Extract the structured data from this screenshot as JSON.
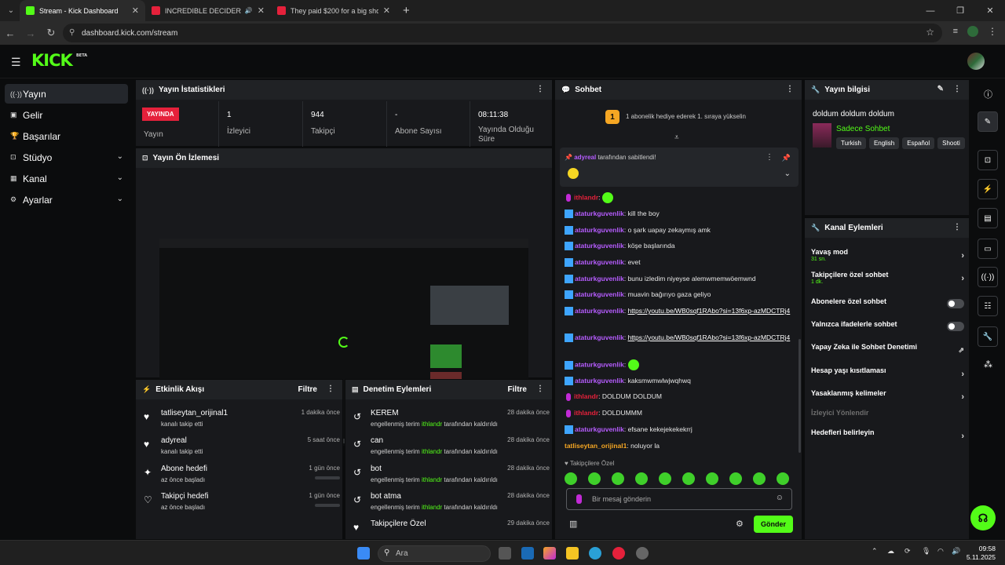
{
  "browser": {
    "tabs": [
      {
        "title": "Stream - Kick Dashboard",
        "active": true
      },
      {
        "title": "INCREDIBLE DECIDER | Roni",
        "active": false
      },
      {
        "title": "They paid $200 for a big shock",
        "active": false
      }
    ],
    "url": "dashboard.kick.com/stream"
  },
  "logo": {
    "text": "KICK",
    "beta": "BETA"
  },
  "sidebar": {
    "items": [
      {
        "label": "Yayın",
        "icon": "broadcast-icon"
      },
      {
        "label": "Gelir",
        "icon": "revenue-icon"
      },
      {
        "label": "Başarılar",
        "icon": "trophy-icon"
      },
      {
        "label": "Stüdyo",
        "icon": "studio-icon"
      },
      {
        "label": "Kanal",
        "icon": "channel-icon"
      },
      {
        "label": "Ayarlar",
        "icon": "settings-icon"
      }
    ]
  },
  "stats": {
    "title": "Yayın İstatistikleri",
    "live_badge": "YAYINDA",
    "items": [
      {
        "value": "",
        "label": "Yayın"
      },
      {
        "value": "1",
        "label": "İzleyici"
      },
      {
        "value": "944",
        "label": "Takipçi"
      },
      {
        "value": "-",
        "label": "Abone Sayısı"
      },
      {
        "value": "08:11:38",
        "label": "Yayında Olduğu Süre"
      }
    ]
  },
  "preview": {
    "title": "Yayın Ön İzlemesi"
  },
  "activity": {
    "title": "Etkinlik Akışı",
    "filter": "Filtre",
    "items": [
      {
        "title": "tatliseytan_orijinal1",
        "sub": "kanalı takip etti",
        "time": "1 dakika önce"
      },
      {
        "title": "adyreal",
        "sub": "kanalı takip etti",
        "time": "5 saat önce"
      },
      {
        "title": "Abone hedefi",
        "sub": "az önce başladı",
        "time": "1 gün önce"
      },
      {
        "title": "Takipçi hedefi",
        "sub": "az önce başladı",
        "time": "1 gün önce"
      }
    ]
  },
  "moderation": {
    "title": "Denetim Eylemleri",
    "filter": "Filtre",
    "items": [
      {
        "title": "KEREM",
        "sub_a": "engellenmiş terim",
        "mod": "ithlandr",
        "sub_b": "tarafından kaldırıldı",
        "time": "28 dakika önce"
      },
      {
        "title": "can",
        "sub_a": "engellenmiş terim",
        "mod": "ithlandr",
        "sub_b": "tarafından kaldırıldı",
        "time": "28 dakika önce"
      },
      {
        "title": "bot",
        "sub_a": "engellenmiş terim",
        "mod": "ithlandr",
        "sub_b": "tarafından kaldırıldı",
        "time": "28 dakika önce"
      },
      {
        "title": "bot atma",
        "sub_a": "engellenmiş terim",
        "mod": "ithlandr",
        "sub_b": "tarafından kaldırıldı",
        "time": "28 dakika önce"
      },
      {
        "title": "Takipçilere Özel",
        "sub_a": "",
        "mod": "",
        "sub_b": "",
        "time": "29 dakika önce"
      }
    ]
  },
  "chat": {
    "title": "Sohbet",
    "gift_rank": "1",
    "gift_text": "1 abonelik hediye ederek 1. sıraya yükselin",
    "pinned_user": "adyreal",
    "pinned_text": "tarafından sabitlendi!",
    "messages": [
      {
        "user": "ithlandr",
        "type": "mod",
        "text": ""
      },
      {
        "user": "ataturkguvenlik",
        "type": "verified",
        "text": "kill the boy"
      },
      {
        "user": "ataturkguvenlik",
        "type": "verified",
        "text": "o şark uapay zekaymış amk"
      },
      {
        "user": "ataturkguvenlik",
        "type": "verified",
        "text": "köşe başlarında"
      },
      {
        "user": "ataturkguvenlik",
        "type": "verified",
        "text": "evet"
      },
      {
        "user": "ataturkguvenlik",
        "type": "verified",
        "text": "bunu izledim niyeyse alemwmemwöemwnd"
      },
      {
        "user": "ataturkguvenlik",
        "type": "verified",
        "text": "muavin bağırıyo gaza geliyo"
      },
      {
        "user": "ataturkguvenlik",
        "type": "verified",
        "link": "https://youtu.be/WB0sqf1RAbo?si=13f6xp-azMDCTRj4"
      },
      {
        "user": "ataturkguvenlik",
        "type": "verified",
        "link": "https://youtu.be/WB0sqf1RAbo?si=13f6xp-azMDCTRj4"
      },
      {
        "user": "ataturkguvenlik",
        "type": "verified",
        "text": ""
      },
      {
        "user": "ataturkguvenlik",
        "type": "verified",
        "text": "kaksmwmwlwjwqhwq"
      },
      {
        "user": "ithlandr",
        "type": "mod",
        "text": "DOLDUM DOLDUM"
      },
      {
        "user": "ithlandr",
        "type": "mod",
        "text": "DOLDUMMM"
      },
      {
        "user": "ataturkguvenlik",
        "type": "verified",
        "text": "efsane kekejekekekrrj"
      },
      {
        "user": "tatliseytan_orijinal1",
        "type": "plain",
        "text": "noluyor la"
      }
    ],
    "followers_only": "Takipçilere Özel",
    "input_placeholder": "Bir mesaj gönderin",
    "send_label": "Gönder"
  },
  "stream_info": {
    "title": "Yayın bilgisi",
    "stream_title": "doldum doldum doldum",
    "category": "Sadece Sohbet",
    "tags": [
      "Turkish",
      "English",
      "Español",
      "Shooti"
    ]
  },
  "channel_actions": {
    "title": "Kanal Eylemleri",
    "items": [
      {
        "label": "Yavaş mod",
        "sub": "31 sn.",
        "control": "chevron"
      },
      {
        "label": "Takipçilere özel sohbet",
        "sub": "1 dk.",
        "control": "chevron"
      },
      {
        "label": "Abonelere özel sohbet",
        "sub": "",
        "control": "toggle"
      },
      {
        "label": "Yalnızca ifadelerle sohbet",
        "sub": "",
        "control": "toggle"
      },
      {
        "label": "Yapay Zeka ile Sohbet Denetimi",
        "sub": "",
        "control": "external"
      },
      {
        "label": "Hesap yaşı kısıtlaması",
        "sub": "",
        "control": "chevron"
      },
      {
        "label": "Yasaklanmış kelimeler",
        "sub": "",
        "control": "chevron"
      },
      {
        "label": "İzleyici Yönlendir",
        "sub": "",
        "control": "disabled"
      },
      {
        "label": "Hedefleri belirleyin",
        "sub": "",
        "control": "chevron"
      }
    ]
  },
  "taskbar": {
    "search_placeholder": "Ara",
    "time": "09:58",
    "date": "5.11.2025"
  },
  "colors": {
    "accent": "#53fc18",
    "live": "#e5213b",
    "panel": "#18191c",
    "header": "#202225"
  }
}
